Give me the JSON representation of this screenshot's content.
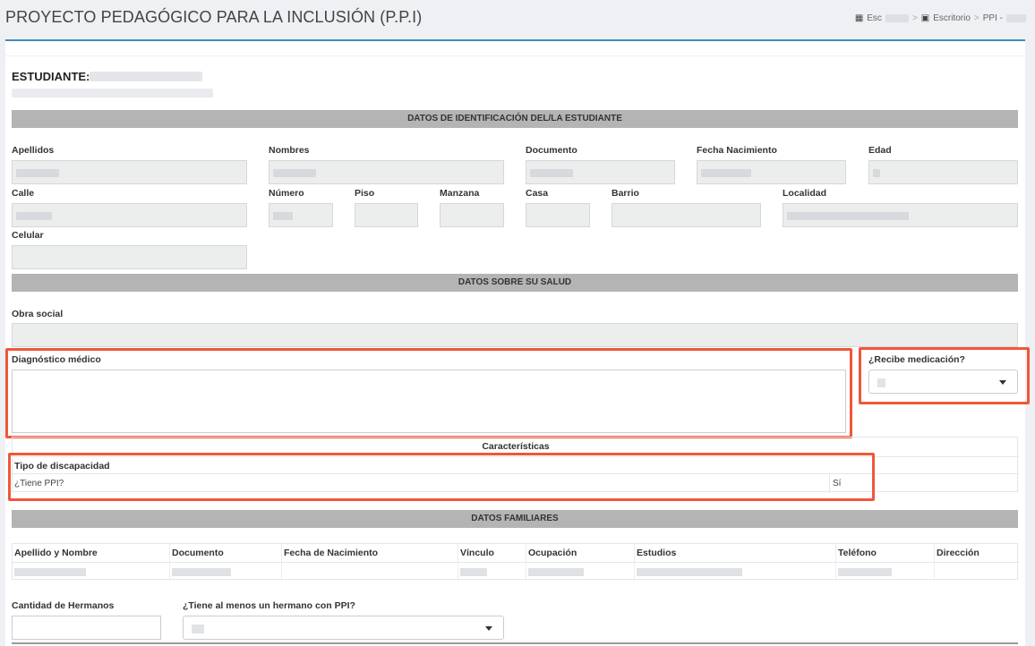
{
  "header": {
    "title": "PROYECTO PEDAGÓGICO PARA LA INCLUSIÓN (P.P.I)",
    "breadcrumb": {
      "school_prefix": "Esc",
      "desk": "Escritorio",
      "ppi_prefix": "PPI -",
      "separator": ">"
    }
  },
  "student": {
    "label": "ESTUDIANTE:"
  },
  "sections": {
    "identification": "DATOS DE IDENTIFICACIÓN DEL/LA ESTUDIANTE",
    "health": "DATOS SOBRE SU SALUD",
    "family": "DATOS FAMILIARES"
  },
  "identification": {
    "apellidos": "Apellidos",
    "nombres": "Nombres",
    "documento": "Documento",
    "fecha_nacimiento": "Fecha Nacimiento",
    "edad": "Edad",
    "calle": "Calle",
    "numero": "Número",
    "piso": "Piso",
    "manzana": "Manzana",
    "casa": "Casa",
    "barrio": "Barrio",
    "localidad": "Localidad",
    "celular": "Celular"
  },
  "health": {
    "obra_social": "Obra social",
    "diagnostico": "Diagnóstico médico",
    "recibe_medicacion": "¿Recibe medicación?"
  },
  "characteristics": {
    "title": "Características",
    "tipo_discapacidad": "Tipo de discapacidad",
    "tiene_ppi_q": "¿Tiene PPI?",
    "tiene_ppi_a": "Sí"
  },
  "family": {
    "columns": [
      "Apellido y Nombre",
      "Documento",
      "Fecha de Nacimiento",
      "Vínculo",
      "Ocupación",
      "Estudios",
      "Teléfono",
      "Dirección"
    ],
    "cantidad_hermanos": "Cantidad de Hermanos",
    "hermano_ppi": "¿Tiene al menos un hermano con PPI?"
  },
  "colors": {
    "accent": "#3c8dbc",
    "highlight": "#f0573a",
    "section_bar": "#b4b4b4"
  }
}
